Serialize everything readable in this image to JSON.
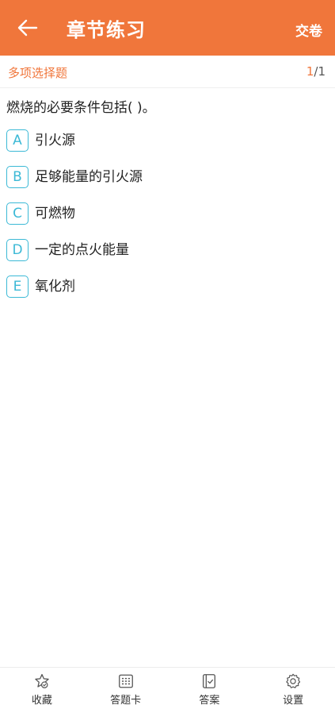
{
  "header": {
    "title": "章节练习",
    "submit_label": "交卷",
    "background_color": "#f0763b"
  },
  "subheader": {
    "question_type": "多项选择题",
    "current": "1",
    "total": "/1"
  },
  "question": {
    "text": "燃烧的必要条件包括(    )。"
  },
  "options": [
    {
      "letter": "A",
      "text": "引火源"
    },
    {
      "letter": "B",
      "text": "足够能量的引火源"
    },
    {
      "letter": "C",
      "text": "可燃物"
    },
    {
      "letter": "D",
      "text": "一定的点火能量"
    },
    {
      "letter": "E",
      "text": "氧化剂"
    }
  ],
  "bottom_tabs": [
    {
      "label": "收藏",
      "icon": "star-icon"
    },
    {
      "label": "答题卡",
      "icon": "answer-card-icon"
    },
    {
      "label": "答案",
      "icon": "answer-icon"
    },
    {
      "label": "设置",
      "icon": "gear-icon"
    }
  ],
  "colors": {
    "accent": "#f0763b",
    "option_border": "#3cb9d6"
  }
}
